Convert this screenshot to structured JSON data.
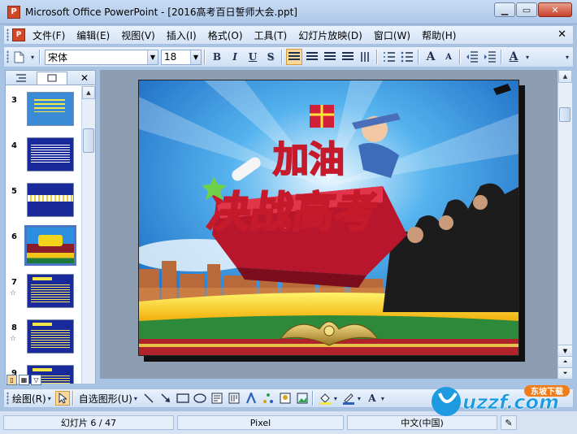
{
  "window": {
    "title": "Microsoft Office PowerPoint - [2016高考百日誓师大会.ppt]",
    "app_icon": "P",
    "minimize": "▁",
    "restore": "▭",
    "close": "✕"
  },
  "menubar": {
    "items": [
      "文件(F)",
      "编辑(E)",
      "视图(V)",
      "插入(I)",
      "格式(O)",
      "工具(T)",
      "幻灯片放映(D)",
      "窗口(W)",
      "帮助(H)"
    ],
    "close": "✕"
  },
  "toolbar": {
    "font_name": "宋体",
    "font_size": "18",
    "bold": "B",
    "italic": "I",
    "underline": "U",
    "shadow": "S",
    "increase_font": "A",
    "decrease_font": "A",
    "font_color": "A",
    "accent_color": "#fbd79a"
  },
  "outline_panel": {
    "close": "✕",
    "slides": [
      {
        "number": "3",
        "style": "lightblue",
        "star": ""
      },
      {
        "number": "4",
        "style": "navy",
        "star": ""
      },
      {
        "number": "5",
        "style": "band",
        "star": ""
      },
      {
        "number": "6",
        "style": "poster",
        "star": "",
        "selected": true
      },
      {
        "number": "7",
        "style": "yellowtext",
        "star": "☆"
      },
      {
        "number": "8",
        "style": "yellowtext",
        "star": "☆"
      },
      {
        "number": "9",
        "style": "yellowtext",
        "star": ""
      }
    ]
  },
  "slide": {
    "headline_top": "加油",
    "headline_main": "决战高考"
  },
  "drawing_toolbar": {
    "draw_label": "绘图(R)",
    "autoshape_label": "自选图形(U)"
  },
  "statusbar": {
    "slide_info": "幻灯片 6 / 47",
    "design": "Pixel",
    "language": "中文(中国)"
  },
  "watermark": {
    "brand": "uzzf.com",
    "tag": "东坡下载"
  }
}
